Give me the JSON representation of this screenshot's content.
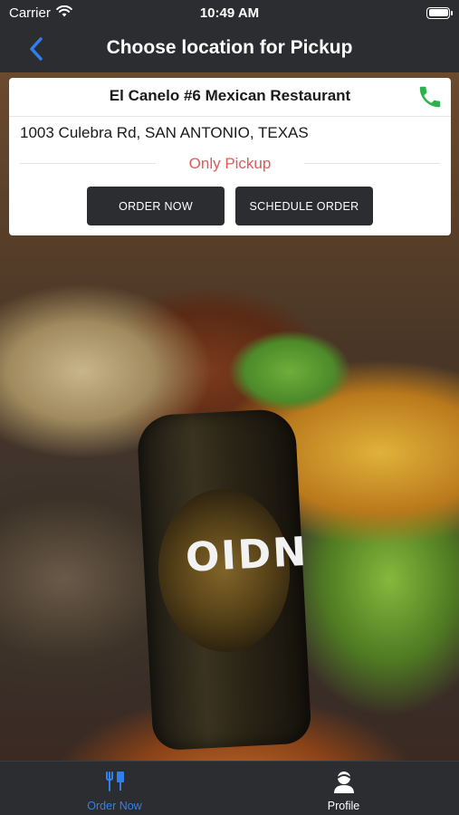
{
  "status_bar": {
    "carrier": "Carrier",
    "time": "10:49 AM"
  },
  "nav": {
    "title": "Choose location for Pickup",
    "back_icon": "chevron-left-icon",
    "accent_color": "#2f80ed"
  },
  "location": {
    "name": "El Canelo #6 Mexican Restaurant",
    "address": "1003 Culebra Rd, SAN ANTONIO, TEXAS",
    "pickup_note": "Only Pickup",
    "phone_icon": "phone-icon",
    "phone_icon_color": "#2bb24c",
    "pickup_note_color": "#e05a5a",
    "buttons": {
      "order_now": "ORDER NOW",
      "schedule_order": "SCHEDULE ORDER"
    }
  },
  "background": {
    "bottle_text": "OIDN"
  },
  "tab_bar": {
    "tabs": [
      {
        "label": "Order Now",
        "icon": "fork-knife-icon",
        "active": true
      },
      {
        "label": "Profile",
        "icon": "user-icon",
        "active": false
      }
    ]
  }
}
